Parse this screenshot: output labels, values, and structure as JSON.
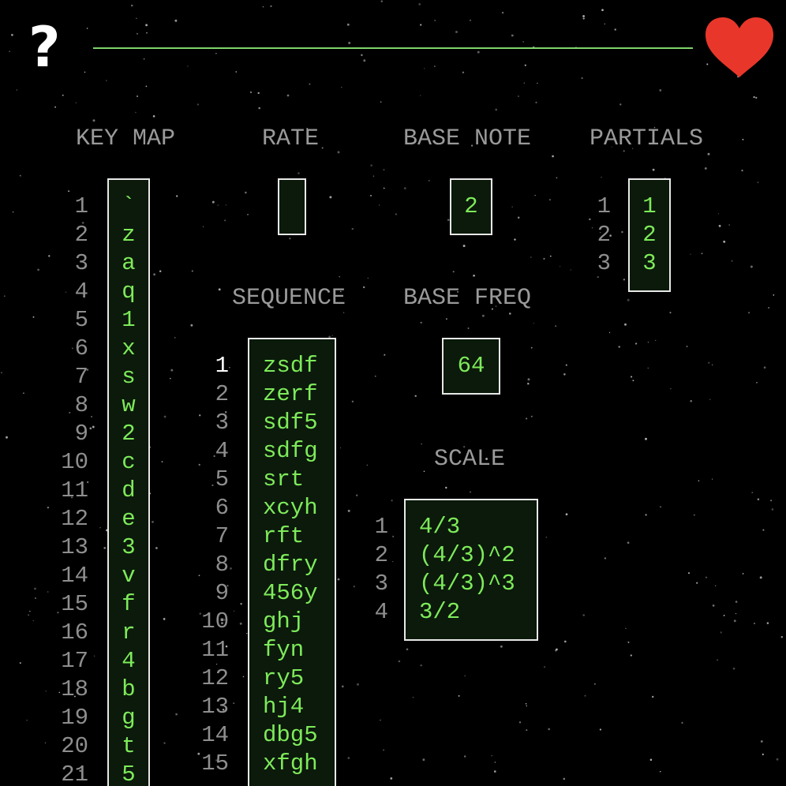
{
  "header": {
    "help_label": "?",
    "heart_color": "#e8372a",
    "line_color": "#7ed46a",
    "help_icon": "question-mark-icon",
    "favorite_icon": "heart-icon"
  },
  "keymap": {
    "title": "KEY MAP",
    "indices": [
      "1",
      "2",
      "3",
      "4",
      "5",
      "6",
      "7",
      "8",
      "9",
      "10",
      "11",
      "12",
      "13",
      "14",
      "15",
      "16",
      "17",
      "18",
      "19",
      "20",
      "21"
    ],
    "keys": [
      "`",
      "z",
      "a",
      "q",
      "1",
      "x",
      "s",
      "w",
      "2",
      "c",
      "d",
      "e",
      "3",
      "v",
      "f",
      "r",
      "4",
      "b",
      "g",
      "t",
      "5"
    ]
  },
  "rate": {
    "title": "RATE",
    "value": ""
  },
  "base_note": {
    "title": "BASE NOTE",
    "value": "2"
  },
  "partials": {
    "title": "PARTIALS",
    "indices": [
      "1",
      "2",
      "3"
    ],
    "values": [
      "1",
      "2",
      "3"
    ]
  },
  "sequence": {
    "title": "SEQUENCE",
    "indices": [
      "1",
      "2",
      "3",
      "4",
      "5",
      "6",
      "7",
      "8",
      "9",
      "10",
      "11",
      "12",
      "13",
      "14",
      "15"
    ],
    "active_index": "1",
    "values": [
      "zsdf",
      "zerf",
      "sdf5",
      "sdfg",
      "srt",
      "xcyh",
      "rft",
      "dfry",
      "456y",
      "ghj",
      "fyn",
      "ry5",
      "hj4",
      "dbg5",
      "xfgh"
    ]
  },
  "base_freq": {
    "title": "BASE FREQ",
    "value": "64"
  },
  "scale": {
    "title": "SCALE",
    "indices": [
      "1",
      "2",
      "3",
      "4"
    ],
    "values": [
      "4/3",
      "(4/3)^2",
      "(4/3)^3",
      "3/2"
    ]
  },
  "colors": {
    "background": "#000000",
    "text_green": "#7eea5a",
    "label_gray": "#9a9a9a",
    "box_fill": "#0b1a0b",
    "box_border": "#e8e8e8"
  }
}
